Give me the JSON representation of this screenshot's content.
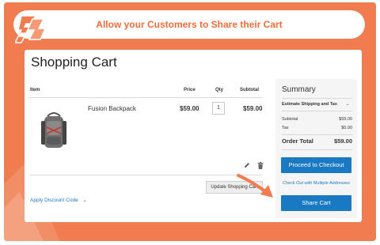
{
  "banner": {
    "title": "Allow your Customers to Share their Cart"
  },
  "page": {
    "title": "Shopping Cart"
  },
  "cart": {
    "headers": {
      "item": "Item",
      "price": "Price",
      "qty": "Qty",
      "subtotal": "Subtotal"
    },
    "items": [
      {
        "name": "Fusion Backpack",
        "price": "$59.00",
        "qty": "1",
        "subtotal": "$59.00"
      }
    ],
    "update_label": "Update Shopping Cart",
    "discount_label": "Apply Discount Code"
  },
  "summary": {
    "title": "Summary",
    "shipping_label": "Estimate Shipping and Tax",
    "subtotal_label": "Subtotal",
    "subtotal_value": "$59.00",
    "tax_label": "Tax",
    "tax_value": "$0.00",
    "order_total_label": "Order Total",
    "order_total_value": "$59.00",
    "checkout_label": "Proceed to Checkout",
    "multi_address_label": "Check Out with Multiple Addresses",
    "share_label": "Share Cart"
  },
  "colors": {
    "accent": "#f07c4f",
    "link": "#1979c3",
    "button": "#1979c3"
  },
  "icons": [
    "brand-logo-icon",
    "backpack-image",
    "edit-icon",
    "trash-icon",
    "chevron-down-icon",
    "arrow-icon"
  ]
}
